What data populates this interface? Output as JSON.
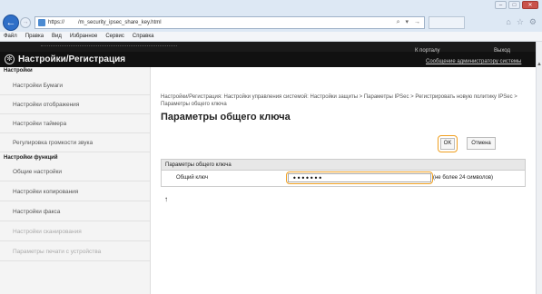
{
  "browser": {
    "url": "https://     /m_security_ipsec_share_key.html",
    "url_tools": [
      "⌕",
      "▾",
      "→"
    ],
    "menu": [
      "Файл",
      "Правка",
      "Вид",
      "Избранное",
      "Сервис",
      "Справка"
    ]
  },
  "header": {
    "title": "Настройки/Регистрация",
    "to_portal": "К порталу",
    "logout": "Выход",
    "admin_message": "Сообщение администратору системы"
  },
  "sidebar": {
    "section1": "Настройки",
    "items1": [
      "Настройки Бумаги",
      "Настройки отображения",
      "Настройки таймера",
      "Регулировка громкости звука"
    ],
    "section2": "Настройки функций",
    "items2": [
      "Общие настройки",
      "Настройки копирования",
      "Настройки факса",
      "Настройки сканирования",
      "Параметры печати с устройства"
    ]
  },
  "main": {
    "breadcrumb": "Настройки/Регистрация: Настройки управления системой: Настройки защиты > Параметры IPSec > Регистрировать новую политику IPSec > Параметры общего ключа",
    "title": "Параметры общего ключа",
    "ok_label": "OK",
    "cancel_label": "Отмена",
    "table_header": "Параметры общего ключа",
    "key_label": "Общий ключ",
    "key_value": "•••••••",
    "key_hint": "(не более 24 символов)",
    "top_marker": "↑"
  },
  "icons": {
    "back": "back-arrow-icon",
    "forward": "forward-arrow-icon",
    "logo": "machine-logo-icon"
  },
  "colors": {
    "highlight": "#f0a020",
    "header_bg": "#111111",
    "back_button": "#2f6fc7"
  }
}
